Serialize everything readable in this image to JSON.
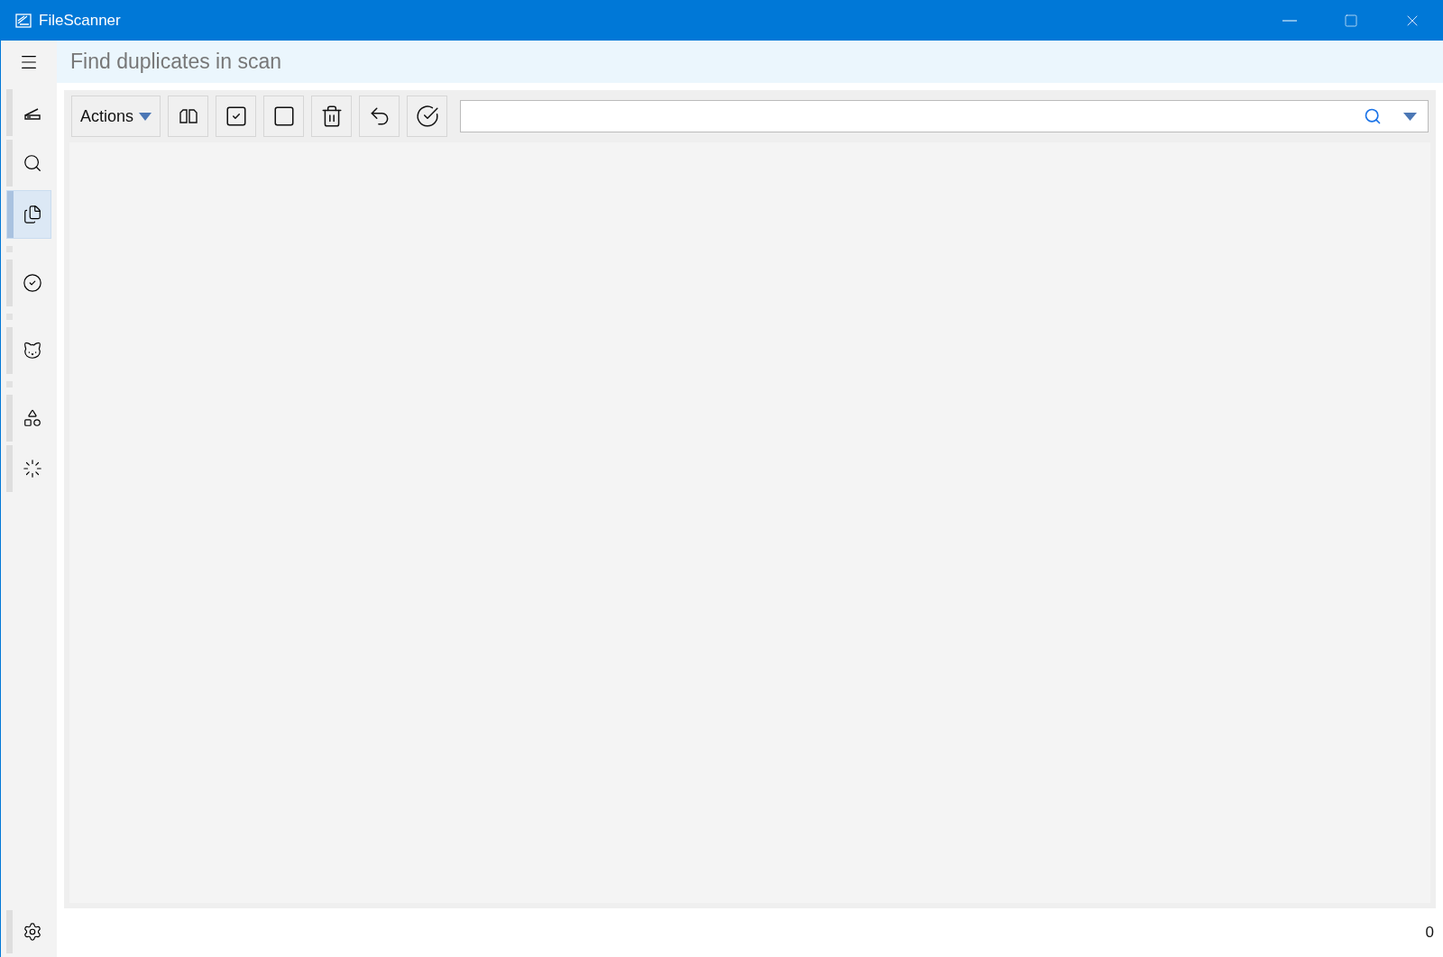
{
  "window": {
    "title": "FileScanner"
  },
  "page": {
    "title": "Find duplicates in scan"
  },
  "nav": [
    {
      "kind": "scanner",
      "selected": false,
      "separator_after": false
    },
    {
      "kind": "search",
      "selected": false,
      "separator_after": false
    },
    {
      "kind": "duplicates",
      "selected": true,
      "separator_after": true
    },
    {
      "kind": "check",
      "selected": false,
      "separator_after": true
    },
    {
      "kind": "cat",
      "selected": false,
      "separator_after": true
    },
    {
      "kind": "apps",
      "selected": false,
      "separator_after": false
    },
    {
      "kind": "progress",
      "selected": false,
      "separator_after": false
    }
  ],
  "toolbar": {
    "actions_label": "Actions",
    "tools": [
      {
        "kind": "compare"
      },
      {
        "kind": "check_all"
      },
      {
        "kind": "uncheck_all"
      },
      {
        "kind": "delete"
      },
      {
        "kind": "undo"
      },
      {
        "kind": "apply"
      }
    ]
  },
  "status_bar": {
    "count": "0"
  }
}
